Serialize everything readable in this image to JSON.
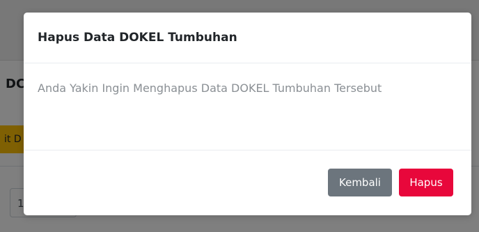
{
  "background": {
    "heading_fragment": "DC",
    "yellow_button_fragment": "it D",
    "select_fragment": "1"
  },
  "modal": {
    "title": "Hapus Data DOKEL Tumbuhan",
    "message": "Anda Yakin Ingin Menghapus Data DOKEL Tumbuhan Tersebut",
    "buttons": {
      "back_label": "Kembali",
      "delete_label": "Hapus"
    }
  },
  "colors": {
    "danger": "#e8073b",
    "secondary": "#6c757d",
    "warning": "#ffc107"
  }
}
